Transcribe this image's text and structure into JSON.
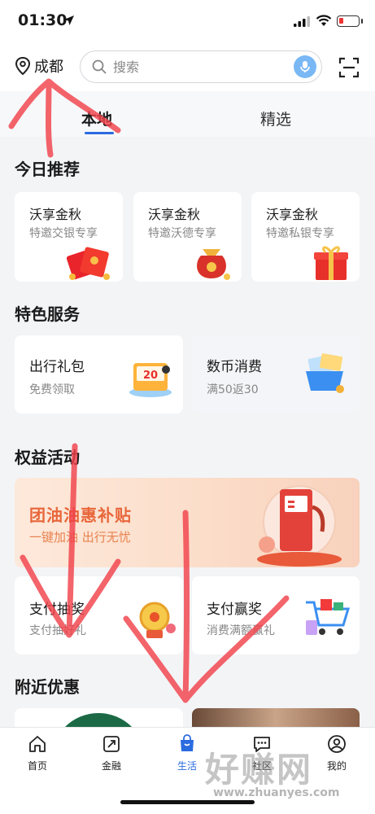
{
  "status_bar": {
    "time": "01:30"
  },
  "header": {
    "city": "成都",
    "search_placeholder": "搜索"
  },
  "tabs": [
    {
      "label": "本地",
      "active": true
    },
    {
      "label": "精选",
      "active": false
    }
  ],
  "today": {
    "title": "今日推荐",
    "cards": [
      {
        "title": "沃享金秋",
        "subtitle": "特邀交银专享"
      },
      {
        "title": "沃享金秋",
        "subtitle": "特邀沃德专享"
      },
      {
        "title": "沃享金秋",
        "subtitle": "特邀私银专享"
      }
    ]
  },
  "services": {
    "title": "特色服务",
    "cards": [
      {
        "title": "出行礼包",
        "subtitle": "免费领取",
        "badge": "20"
      },
      {
        "title": "数币消费",
        "subtitle": "满50返30"
      }
    ]
  },
  "benefits": {
    "title": "权益活动",
    "banner": {
      "title": "团油油惠补贴",
      "subtitle": "一键加油 出行无忧"
    },
    "cards": [
      {
        "title": "支付抽奖",
        "subtitle": "支付抽好礼"
      },
      {
        "title": "支付赢奖",
        "subtitle": "消费满额赢礼"
      }
    ]
  },
  "nearby": {
    "title": "附近优惠"
  },
  "tabbar": [
    {
      "label": "首页",
      "icon": "home-icon",
      "active": false
    },
    {
      "label": "金融",
      "icon": "finance-icon",
      "active": false
    },
    {
      "label": "生活",
      "icon": "shopping-bag-icon",
      "active": true
    },
    {
      "label": "社区",
      "icon": "chat-bubble-icon",
      "active": false
    },
    {
      "label": "我的",
      "icon": "user-icon",
      "active": false
    }
  ],
  "watermark": {
    "text": "好赚网",
    "url": "www.zhuanyes.com"
  },
  "colors": {
    "accent": "#2a6be0",
    "annotation": "#f0424a",
    "banner_text": "#e8663a"
  }
}
